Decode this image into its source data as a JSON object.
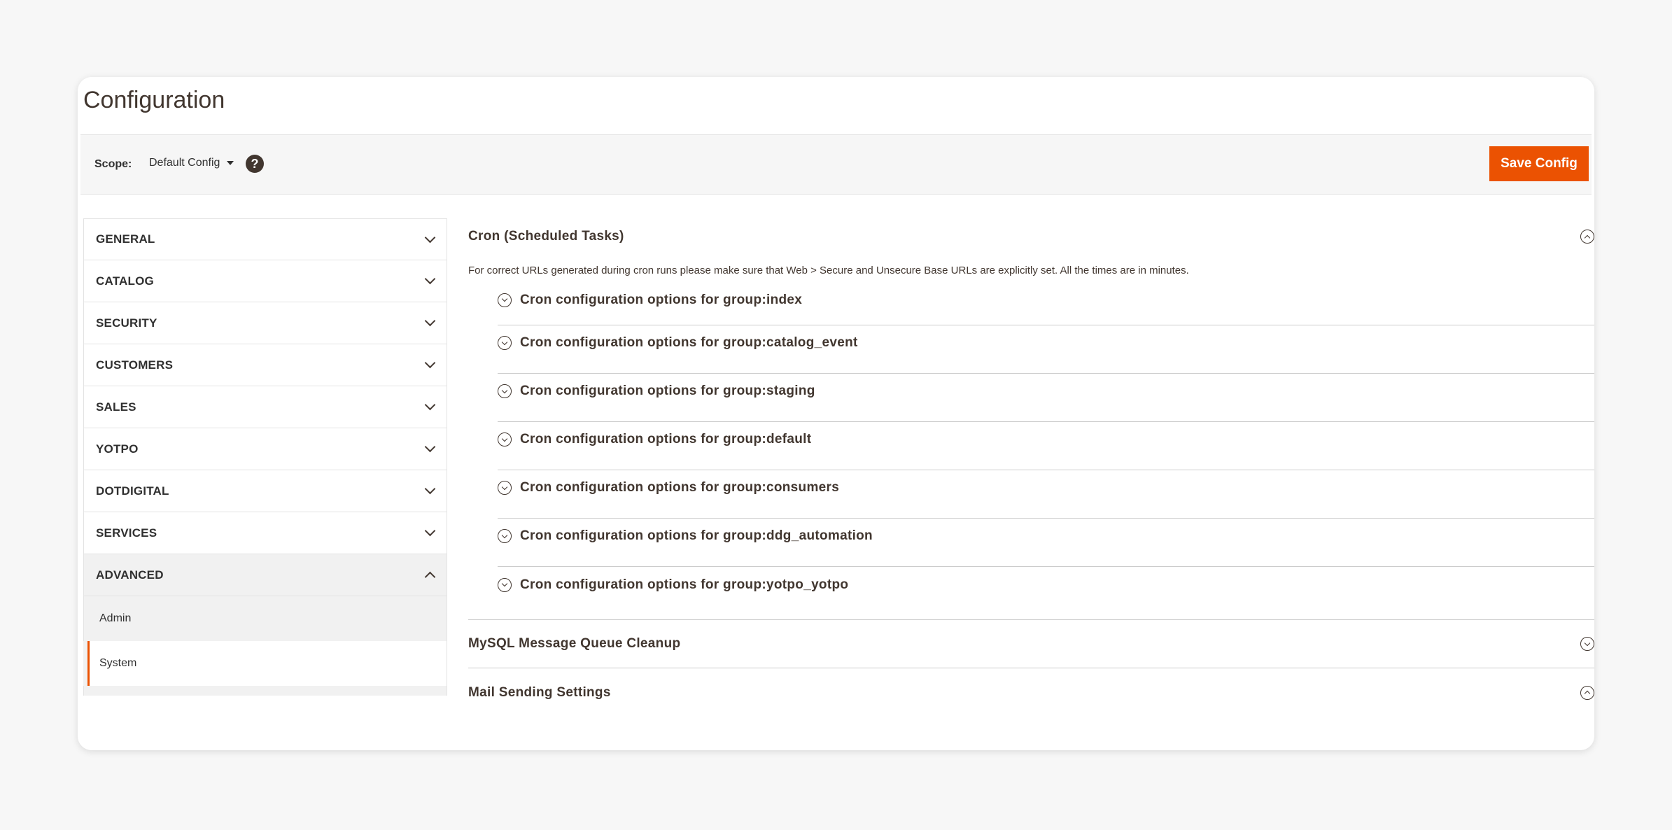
{
  "page": {
    "title": "Configuration"
  },
  "scope": {
    "label": "Scope:",
    "value": "Default Config",
    "help": "?"
  },
  "toolbar": {
    "save_label": "Save Config"
  },
  "colors": {
    "accent": "#eb5202",
    "text": "#41362f",
    "sidebar_active_bg": "#f1f1f1"
  },
  "sidebar": {
    "items": [
      {
        "label": "GENERAL",
        "open": false
      },
      {
        "label": "CATALOG",
        "open": false
      },
      {
        "label": "SECURITY",
        "open": false
      },
      {
        "label": "CUSTOMERS",
        "open": false
      },
      {
        "label": "SALES",
        "open": false
      },
      {
        "label": "YOTPO",
        "open": false
      },
      {
        "label": "DOTDIGITAL",
        "open": false
      },
      {
        "label": "SERVICES",
        "open": false
      },
      {
        "label": "ADVANCED",
        "open": true
      }
    ],
    "subitems": [
      {
        "label": "Admin",
        "active": false
      },
      {
        "label": "System",
        "active": true
      }
    ]
  },
  "main": {
    "cron": {
      "title": "Cron (Scheduled Tasks)",
      "note": "For correct URLs generated during cron runs please make sure that Web > Secure and Unsecure Base URLs are explicitly set. All the times are in minutes.",
      "groups": [
        "Cron configuration options for group:index",
        "Cron configuration options for group:catalog_event",
        "Cron configuration options for group:staging",
        "Cron configuration options for group:default",
        "Cron configuration options for group:consumers",
        "Cron configuration options for group:ddg_automation",
        "Cron configuration options for group:yotpo_yotpo"
      ]
    },
    "sections": [
      {
        "title": "MySQL Message Queue Cleanup"
      },
      {
        "title": "Mail Sending Settings"
      }
    ]
  }
}
